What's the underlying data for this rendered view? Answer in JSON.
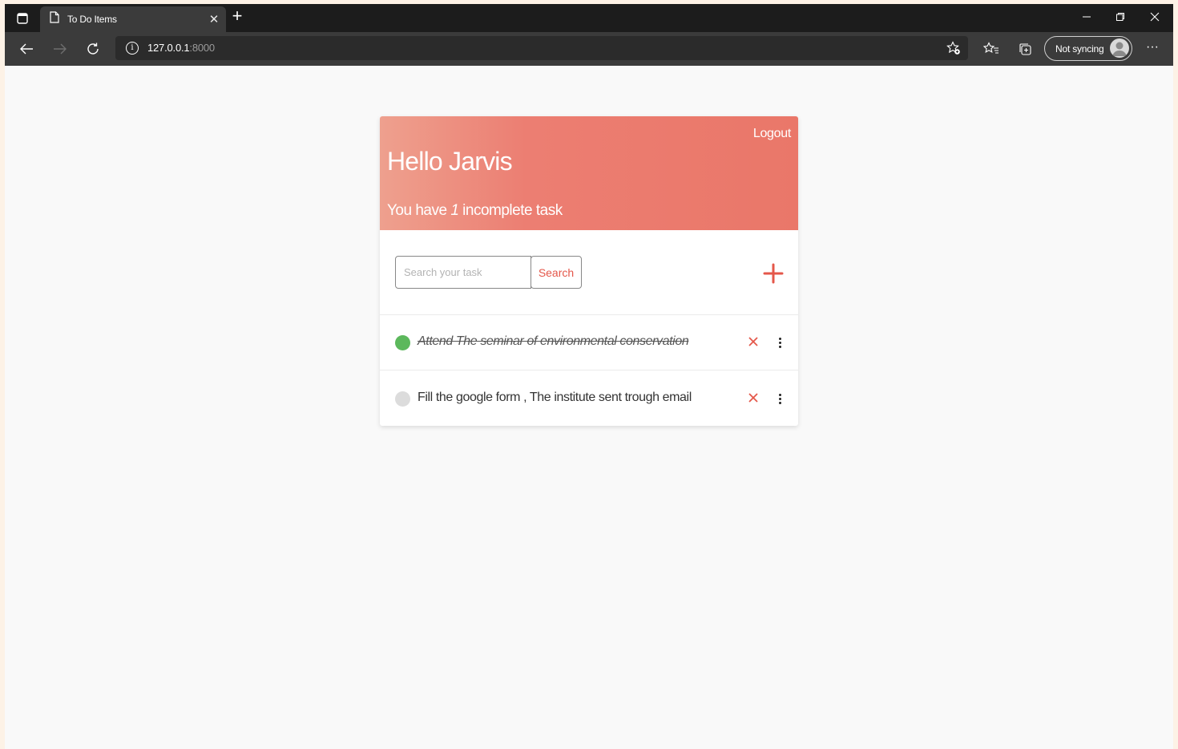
{
  "browser": {
    "tab_title": "To Do Items",
    "url_host": "127.0.0.1",
    "url_port": ":8000",
    "sync_label": "Not syncing",
    "more_label": "···"
  },
  "app": {
    "logout_label": "Logout",
    "greeting": "Hello Jarvis",
    "summary_prefix": "You have ",
    "incomplete_count": "1",
    "summary_suffix": " incomplete task",
    "search_placeholder": "Search your task",
    "search_value": "",
    "search_label": "Search",
    "accent_color": "#e4574a",
    "tasks": [
      {
        "text": "Attend The seminar of environmental conservation",
        "completed": true,
        "status_color": "#5cb85c"
      },
      {
        "text": "Fill the google form , The institute sent trough email",
        "completed": false,
        "status_color": "#dcdcdc"
      }
    ]
  }
}
